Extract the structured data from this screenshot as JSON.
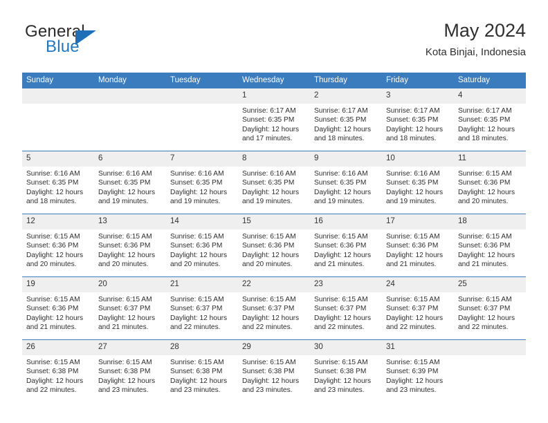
{
  "brand": {
    "line1": "General",
    "line2": "Blue",
    "triangle_color": "#1f6fb8",
    "blue_text_color": "#1f77c4"
  },
  "header": {
    "title": "May 2024",
    "subtitle": "Kota Binjai, Indonesia"
  },
  "calendar": {
    "accent_color": "#3a7cbe",
    "daynum_band_color": "#efefef",
    "weekdays": [
      "Sunday",
      "Monday",
      "Tuesday",
      "Wednesday",
      "Thursday",
      "Friday",
      "Saturday"
    ],
    "weeks": [
      [
        {
          "day": "",
          "sunrise": "",
          "sunset": "",
          "daylight": "",
          "empty": true
        },
        {
          "day": "",
          "sunrise": "",
          "sunset": "",
          "daylight": "",
          "empty": true
        },
        {
          "day": "",
          "sunrise": "",
          "sunset": "",
          "daylight": "",
          "empty": true
        },
        {
          "day": "1",
          "sunrise": "Sunrise: 6:17 AM",
          "sunset": "Sunset: 6:35 PM",
          "daylight": "Daylight: 12 hours and 17 minutes."
        },
        {
          "day": "2",
          "sunrise": "Sunrise: 6:17 AM",
          "sunset": "Sunset: 6:35 PM",
          "daylight": "Daylight: 12 hours and 18 minutes."
        },
        {
          "day": "3",
          "sunrise": "Sunrise: 6:17 AM",
          "sunset": "Sunset: 6:35 PM",
          "daylight": "Daylight: 12 hours and 18 minutes."
        },
        {
          "day": "4",
          "sunrise": "Sunrise: 6:17 AM",
          "sunset": "Sunset: 6:35 PM",
          "daylight": "Daylight: 12 hours and 18 minutes."
        }
      ],
      [
        {
          "day": "5",
          "sunrise": "Sunrise: 6:16 AM",
          "sunset": "Sunset: 6:35 PM",
          "daylight": "Daylight: 12 hours and 18 minutes."
        },
        {
          "day": "6",
          "sunrise": "Sunrise: 6:16 AM",
          "sunset": "Sunset: 6:35 PM",
          "daylight": "Daylight: 12 hours and 19 minutes."
        },
        {
          "day": "7",
          "sunrise": "Sunrise: 6:16 AM",
          "sunset": "Sunset: 6:35 PM",
          "daylight": "Daylight: 12 hours and 19 minutes."
        },
        {
          "day": "8",
          "sunrise": "Sunrise: 6:16 AM",
          "sunset": "Sunset: 6:35 PM",
          "daylight": "Daylight: 12 hours and 19 minutes."
        },
        {
          "day": "9",
          "sunrise": "Sunrise: 6:16 AM",
          "sunset": "Sunset: 6:35 PM",
          "daylight": "Daylight: 12 hours and 19 minutes."
        },
        {
          "day": "10",
          "sunrise": "Sunrise: 6:16 AM",
          "sunset": "Sunset: 6:35 PM",
          "daylight": "Daylight: 12 hours and 19 minutes."
        },
        {
          "day": "11",
          "sunrise": "Sunrise: 6:15 AM",
          "sunset": "Sunset: 6:36 PM",
          "daylight": "Daylight: 12 hours and 20 minutes."
        }
      ],
      [
        {
          "day": "12",
          "sunrise": "Sunrise: 6:15 AM",
          "sunset": "Sunset: 6:36 PM",
          "daylight": "Daylight: 12 hours and 20 minutes."
        },
        {
          "day": "13",
          "sunrise": "Sunrise: 6:15 AM",
          "sunset": "Sunset: 6:36 PM",
          "daylight": "Daylight: 12 hours and 20 minutes."
        },
        {
          "day": "14",
          "sunrise": "Sunrise: 6:15 AM",
          "sunset": "Sunset: 6:36 PM",
          "daylight": "Daylight: 12 hours and 20 minutes."
        },
        {
          "day": "15",
          "sunrise": "Sunrise: 6:15 AM",
          "sunset": "Sunset: 6:36 PM",
          "daylight": "Daylight: 12 hours and 20 minutes."
        },
        {
          "day": "16",
          "sunrise": "Sunrise: 6:15 AM",
          "sunset": "Sunset: 6:36 PM",
          "daylight": "Daylight: 12 hours and 21 minutes."
        },
        {
          "day": "17",
          "sunrise": "Sunrise: 6:15 AM",
          "sunset": "Sunset: 6:36 PM",
          "daylight": "Daylight: 12 hours and 21 minutes."
        },
        {
          "day": "18",
          "sunrise": "Sunrise: 6:15 AM",
          "sunset": "Sunset: 6:36 PM",
          "daylight": "Daylight: 12 hours and 21 minutes."
        }
      ],
      [
        {
          "day": "19",
          "sunrise": "Sunrise: 6:15 AM",
          "sunset": "Sunset: 6:36 PM",
          "daylight": "Daylight: 12 hours and 21 minutes."
        },
        {
          "day": "20",
          "sunrise": "Sunrise: 6:15 AM",
          "sunset": "Sunset: 6:37 PM",
          "daylight": "Daylight: 12 hours and 21 minutes."
        },
        {
          "day": "21",
          "sunrise": "Sunrise: 6:15 AM",
          "sunset": "Sunset: 6:37 PM",
          "daylight": "Daylight: 12 hours and 22 minutes."
        },
        {
          "day": "22",
          "sunrise": "Sunrise: 6:15 AM",
          "sunset": "Sunset: 6:37 PM",
          "daylight": "Daylight: 12 hours and 22 minutes."
        },
        {
          "day": "23",
          "sunrise": "Sunrise: 6:15 AM",
          "sunset": "Sunset: 6:37 PM",
          "daylight": "Daylight: 12 hours and 22 minutes."
        },
        {
          "day": "24",
          "sunrise": "Sunrise: 6:15 AM",
          "sunset": "Sunset: 6:37 PM",
          "daylight": "Daylight: 12 hours and 22 minutes."
        },
        {
          "day": "25",
          "sunrise": "Sunrise: 6:15 AM",
          "sunset": "Sunset: 6:37 PM",
          "daylight": "Daylight: 12 hours and 22 minutes."
        }
      ],
      [
        {
          "day": "26",
          "sunrise": "Sunrise: 6:15 AM",
          "sunset": "Sunset: 6:38 PM",
          "daylight": "Daylight: 12 hours and 22 minutes."
        },
        {
          "day": "27",
          "sunrise": "Sunrise: 6:15 AM",
          "sunset": "Sunset: 6:38 PM",
          "daylight": "Daylight: 12 hours and 23 minutes."
        },
        {
          "day": "28",
          "sunrise": "Sunrise: 6:15 AM",
          "sunset": "Sunset: 6:38 PM",
          "daylight": "Daylight: 12 hours and 23 minutes."
        },
        {
          "day": "29",
          "sunrise": "Sunrise: 6:15 AM",
          "sunset": "Sunset: 6:38 PM",
          "daylight": "Daylight: 12 hours and 23 minutes."
        },
        {
          "day": "30",
          "sunrise": "Sunrise: 6:15 AM",
          "sunset": "Sunset: 6:38 PM",
          "daylight": "Daylight: 12 hours and 23 minutes."
        },
        {
          "day": "31",
          "sunrise": "Sunrise: 6:15 AM",
          "sunset": "Sunset: 6:39 PM",
          "daylight": "Daylight: 12 hours and 23 minutes."
        },
        {
          "day": "",
          "sunrise": "",
          "sunset": "",
          "daylight": "",
          "empty": true
        }
      ]
    ]
  }
}
